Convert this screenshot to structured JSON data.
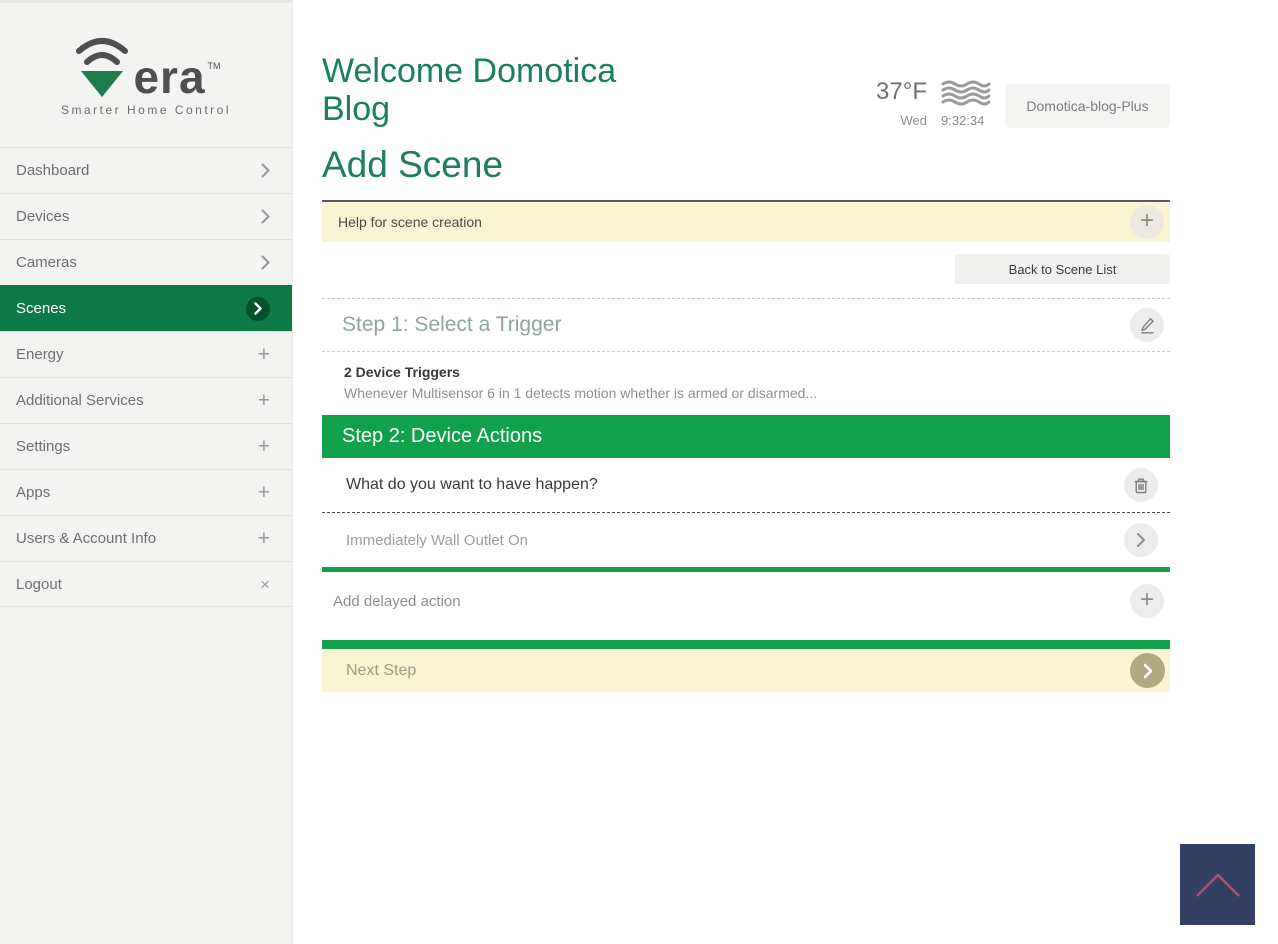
{
  "sidebar": {
    "logo": {
      "brand": "era",
      "tm": "TM",
      "tagline": "Smarter Home Control"
    },
    "items": [
      {
        "label": "Dashboard",
        "icon": "chevron-right"
      },
      {
        "label": "Devices",
        "icon": "chevron-right"
      },
      {
        "label": "Cameras",
        "icon": "chevron-right"
      },
      {
        "label": "Scenes",
        "icon": "chevron-right-circle",
        "active": true
      },
      {
        "label": "Energy",
        "icon": "plus"
      },
      {
        "label": "Additional Services",
        "icon": "plus"
      },
      {
        "label": "Settings",
        "icon": "plus"
      },
      {
        "label": "Apps",
        "icon": "plus"
      },
      {
        "label": "Users & Account Info",
        "icon": "plus"
      },
      {
        "label": "Logout",
        "icon": "close"
      }
    ]
  },
  "header": {
    "welcome": "Welcome Domotica Blog",
    "weather_temp": "37°F",
    "weather_icon": "fog-icon",
    "day": "Wed",
    "time": "9:32:34",
    "controller_name": "Domotica-blog-Plus"
  },
  "page": {
    "title": "Add Scene"
  },
  "help_bar": {
    "label": "Help for scene creation",
    "expand_icon": "plus-icon"
  },
  "back_button": {
    "label": "Back to Scene List"
  },
  "step1": {
    "title": "Step 1: Select a Trigger",
    "edit_icon": "pencil-icon",
    "triggers_count": "2 Device Triggers",
    "trigger_summary": "Whenever Multisensor 6 in 1 detects motion whether is armed or disarmed..."
  },
  "step2": {
    "title": "Step 2: Device Actions",
    "question": "What do you want to have happen?",
    "delete_icon": "trash-icon",
    "action": "Immediately Wall Outlet On",
    "open_icon": "chevron-right-icon",
    "add_delayed": "Add delayed action",
    "add_icon": "plus-icon"
  },
  "next_step": {
    "label": "Next Step",
    "icon": "chevron-right-icon"
  },
  "colors": {
    "accent_green": "#12a14b",
    "sidebar_active_green": "#0d7a45",
    "heading_teal": "#1b7d61",
    "step_heading_sage": "#8ba79c",
    "help_yellow": "#f9f5d2",
    "logo_green": "#1d7b4c",
    "scrolltop_navy": "#333f63",
    "scrolltop_chevron": "#b3506b"
  }
}
